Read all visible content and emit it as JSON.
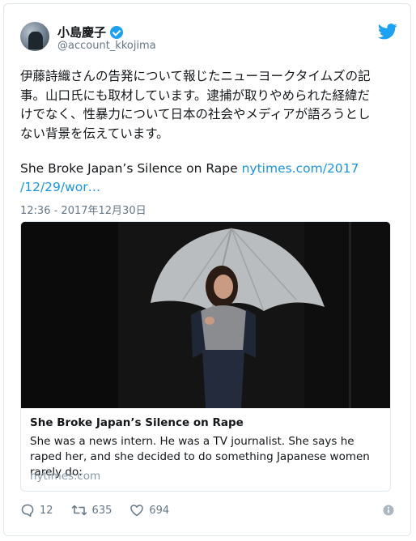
{
  "author": {
    "display_name": "小島慶子",
    "handle": "@account_kkojima"
  },
  "tweet": {
    "text": "伊藤詩織さんの告発について報じたニューヨークタイムズの記\n事。山口氏にも取材しています。逮捕が取りやめられた経緯だ\nけでなく、性暴力について日本の社会やメディアが語ろうとし\nない背景を伝えています。",
    "link_prefix": "She Broke Japan’s Silence on Rape ",
    "link_text_1": "nytimes.com/2017",
    "link_text_2": "/12/29/wor…",
    "timestamp": "12:36 - 2017年12月30日"
  },
  "card": {
    "title": "She Broke Japan’s Silence on Rape",
    "description": "She was a news intern. He was a TV journalist. She says he raped her, and she decided to do something Japanese women rarely do:",
    "domain": "nytimes.com"
  },
  "actions": {
    "replies": "12",
    "retweets": "635",
    "likes": "694"
  },
  "colors": {
    "accent": "#1da1f2",
    "link": "#1b95e0",
    "muted": "#657786",
    "border": "#e1e8ed"
  },
  "icons": [
    "verified-badge-icon",
    "twitter-bird-icon",
    "reply-icon",
    "retweet-icon",
    "like-icon",
    "info-icon"
  ]
}
